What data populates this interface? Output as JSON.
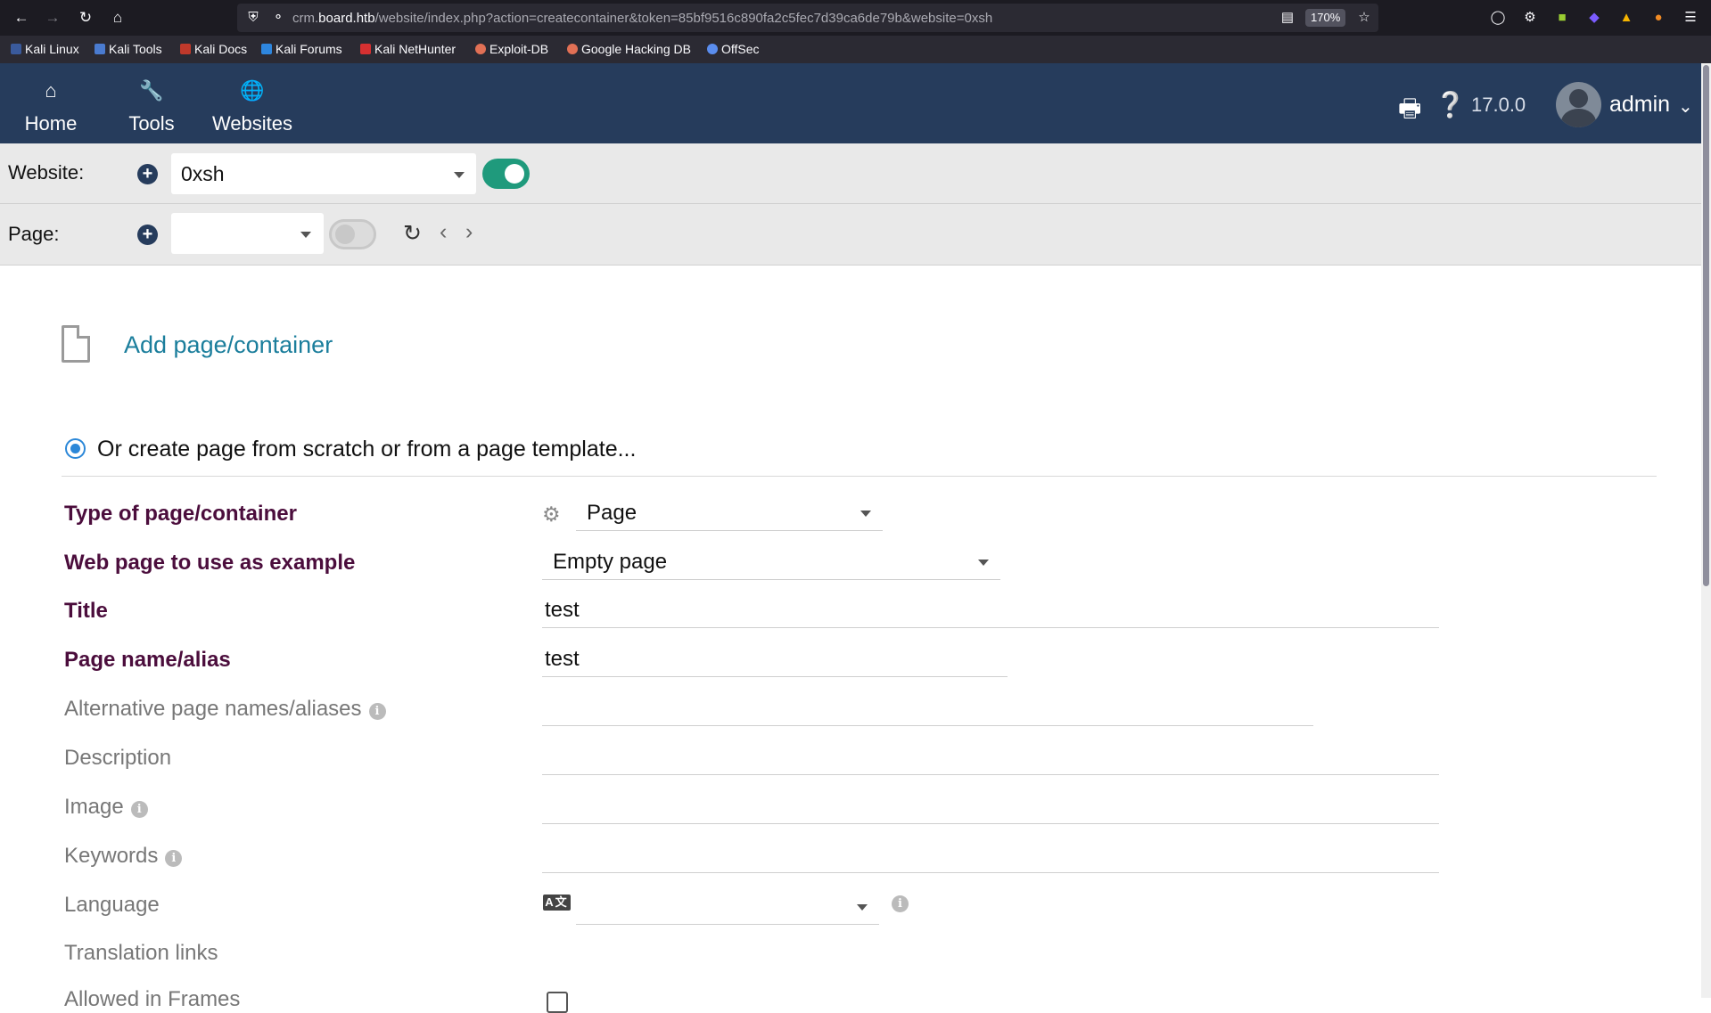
{
  "browser": {
    "url_prefix": "crm.",
    "url_host": "board.htb",
    "url_path": "/website/index.php?action=createcontainer&token=85bf9516c890fa2c5fec7d39ca6de79b&website=0xsh",
    "zoom": "170%",
    "bookmarks": [
      "Kali Linux",
      "Kali Tools",
      "Kali Docs",
      "Kali Forums",
      "Kali NetHunter",
      "Exploit-DB",
      "Google Hacking DB",
      "OffSec"
    ]
  },
  "topnav": {
    "items": [
      {
        "label": "Home",
        "icon": "home-icon"
      },
      {
        "label": "Tools",
        "icon": "wrench-icon"
      },
      {
        "label": "Websites",
        "icon": "globe-icon"
      }
    ],
    "version": "17.0.0",
    "user": "admin"
  },
  "website_bar": {
    "label": "Website:",
    "selected": "0xsh"
  },
  "page_bar": {
    "label": "Page:",
    "selected": ""
  },
  "main": {
    "title": "Add page/container",
    "radio_label": "Or create page from scratch or from a page template..."
  },
  "form": {
    "type_label": "Type of page/container",
    "type_value": "Page",
    "example_label": "Web page to use as example",
    "example_value": "Empty page",
    "title_label": "Title",
    "title_value": "test",
    "alias_label": "Page name/alias",
    "alias_value": "test",
    "alt_alias_label": "Alternative page names/aliases",
    "description_label": "Description",
    "image_label": "Image",
    "keywords_label": "Keywords",
    "language_label": "Language",
    "translation_label": "Translation links",
    "frames_label": "Allowed in Frames"
  },
  "colors": {
    "topnav": "#263c5c",
    "required_label": "#4b0d3c",
    "link": "#1b7e9c",
    "toggle_on": "#1f9a7c"
  }
}
